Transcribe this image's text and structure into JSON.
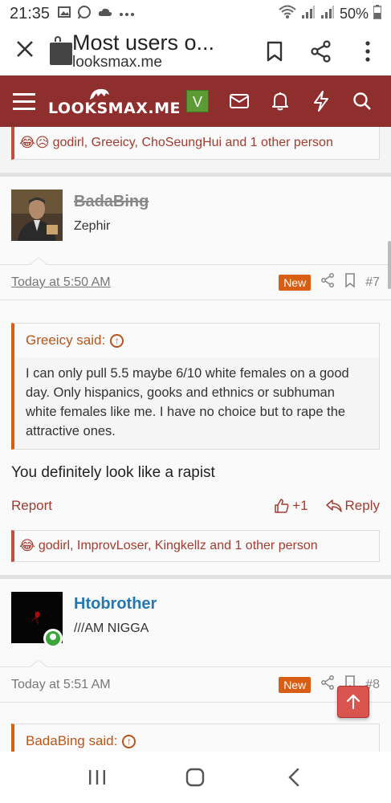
{
  "status_bar": {
    "time": "21:35",
    "battery": "50%"
  },
  "browser": {
    "title": "Most users o...",
    "url": "looksmax.me"
  },
  "site": {
    "logo": "LOOKSMAX.ME",
    "user_badge": "V",
    "brand_color": "#8e2f2d"
  },
  "reaction_bar_top": {
    "text": "godirl, Greeicy, ChoSeungHui and 1 other person"
  },
  "post7": {
    "username": "BadaBing",
    "user_title": "Zephir",
    "date": "Today at 5:50 AM",
    "new_label": "New",
    "post_number": "#7",
    "quote_author": "Greeicy said:",
    "quote_text": "I can only pull 5.5 maybe 6/10 white females on a good day. Only hispanics, gooks and ethnics or subhuman white females like me. I have no choice but to rape the attractive ones.",
    "message": "You definitely look like a rapist",
    "report_label": "Report",
    "like_count": "+1",
    "reply_label": "Reply",
    "reactions": "godirl, ImprovLoser, Kingkellz and 1 other person"
  },
  "post8": {
    "username": "Htobrother",
    "user_title": "///AM NIGGA",
    "date": "Today at 5:51 AM",
    "new_label": "New",
    "post_number": "#8",
    "quote_author": "BadaBing said:"
  }
}
